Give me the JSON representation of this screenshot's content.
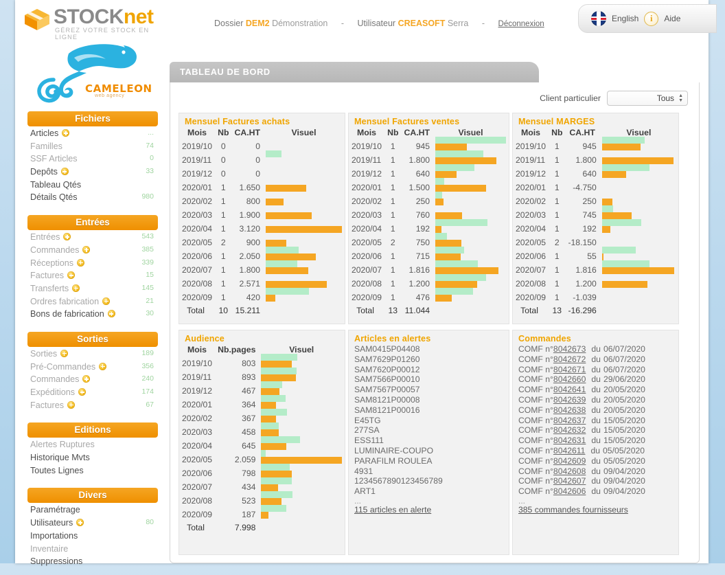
{
  "brand": {
    "name_stock": "STOCK",
    "name_net": "net",
    "tagline": "GÉREZ VOTRE STOCK EN LIGNE",
    "agency_name": "CAMELEON",
    "agency_sub": "web agency"
  },
  "topbar": {
    "dossier_label": "Dossier",
    "dossier_code": "DEM2",
    "dossier_name": "Démonstration",
    "sep": "-",
    "user_label": "Utilisateur",
    "user_code": "CREASOFT",
    "user_name": "Serra",
    "logout": "Déconnexion",
    "language": "English",
    "help": "Aide"
  },
  "page_title": "TABLEAU DE BORD",
  "filter": {
    "label": "Client particulier",
    "value": "Tous",
    "options": [
      "Tous"
    ]
  },
  "sidebar": {
    "sections": [
      {
        "title": "Fichiers",
        "items": [
          {
            "label": "Articles",
            "plus": true,
            "count": "...",
            "dim": false
          },
          {
            "label": "Familles",
            "plus": false,
            "count": "74",
            "dim": true
          },
          {
            "label": "SSF Articles",
            "plus": false,
            "count": "0",
            "dim": true
          },
          {
            "label": "Depôts",
            "plus": true,
            "count": "33",
            "dim": false
          },
          {
            "label": "Tableau Qtés",
            "plus": false,
            "count": "",
            "dim": false
          },
          {
            "label": "Détails Qtés",
            "plus": false,
            "count": "980",
            "dim": false
          }
        ]
      },
      {
        "title": "Entrées",
        "items": [
          {
            "label": "Entrées",
            "plus": true,
            "count": "543",
            "dim": true
          },
          {
            "label": "Commandes",
            "plus": true,
            "count": "385",
            "dim": true
          },
          {
            "label": "Réceptions",
            "plus": true,
            "count": "339",
            "dim": true
          },
          {
            "label": "Factures",
            "plus": true,
            "count": "15",
            "dim": true
          },
          {
            "label": "Transferts",
            "plus": true,
            "count": "145",
            "dim": true
          },
          {
            "label": "Ordres fabrication",
            "plus": true,
            "count": "21",
            "dim": true
          },
          {
            "label": "Bons de fabrication",
            "plus": true,
            "count": "30",
            "dim": false
          }
        ]
      },
      {
        "title": "Sorties",
        "items": [
          {
            "label": "Sorties",
            "plus": true,
            "count": "189",
            "dim": true
          },
          {
            "label": "Pré-Commandes",
            "plus": true,
            "count": "356",
            "dim": true
          },
          {
            "label": "Commandes",
            "plus": true,
            "count": "240",
            "dim": true
          },
          {
            "label": "Expéditions",
            "plus": true,
            "count": "174",
            "dim": true
          },
          {
            "label": "Factures",
            "plus": true,
            "count": "67",
            "dim": true
          }
        ]
      },
      {
        "title": "Editions",
        "items": [
          {
            "label": "Alertes Ruptures",
            "plus": false,
            "count": "",
            "dim": true
          },
          {
            "label": "Historique Mvts",
            "plus": false,
            "count": "",
            "dim": false
          },
          {
            "label": "Toutes Lignes",
            "plus": false,
            "count": "",
            "dim": false
          }
        ]
      },
      {
        "title": "Divers",
        "items": [
          {
            "label": "Paramétrage",
            "plus": false,
            "count": "",
            "dim": false
          },
          {
            "label": "Utilisateurs",
            "plus": true,
            "count": "80",
            "dim": false
          },
          {
            "label": "Importations",
            "plus": false,
            "count": "",
            "dim": false
          },
          {
            "label": "Inventaire",
            "plus": false,
            "count": "",
            "dim": true
          },
          {
            "label": "Suppressions",
            "plus": false,
            "count": "",
            "dim": false
          }
        ]
      }
    ]
  },
  "chart_data": [
    {
      "type": "bar",
      "title": "Mensuel Factures achats",
      "columns": [
        "Mois",
        "Nb",
        "CA.HT",
        "Visuel"
      ],
      "categories": [
        "2019/10",
        "2019/11",
        "2019/12",
        "2020/01",
        "2020/02",
        "2020/03",
        "2020/04",
        "2020/05",
        "2020/06",
        "2020/07",
        "2020/08",
        "2020/09"
      ],
      "nb": [
        "0",
        "0",
        "0",
        "1",
        "1",
        "1",
        "1",
        "2",
        "1",
        "1",
        "1",
        "1"
      ],
      "values": [
        0,
        0,
        0,
        1650,
        800,
        1900,
        3120,
        900,
        2050,
        1800,
        2571,
        420
      ],
      "orange_pct": [
        0,
        0,
        0,
        53,
        23,
        60,
        100,
        27,
        66,
        56,
        80,
        13
      ],
      "green_pct": [
        0,
        21,
        0,
        0,
        0,
        0,
        0,
        0,
        43,
        41,
        0,
        57
      ],
      "total_label": "Total",
      "total_nb": "10",
      "total_value": "15.211",
      "xlabel": "",
      "ylabel": "CA.HT"
    },
    {
      "type": "bar",
      "title": "Mensuel Factures ventes",
      "columns": [
        "Mois",
        "Nb",
        "CA.HT",
        "Visuel"
      ],
      "categories": [
        "2019/10",
        "2019/11",
        "2019/12",
        "2020/01",
        "2020/02",
        "2020/03",
        "2020/04",
        "2020/05",
        "2020/06",
        "2020/07",
        "2020/08",
        "2020/09"
      ],
      "nb": [
        "1",
        "1",
        "1",
        "1",
        "1",
        "1",
        "1",
        "2",
        "1",
        "1",
        "1",
        "1"
      ],
      "values": [
        945,
        1800,
        640,
        1500,
        250,
        760,
        192,
        750,
        715,
        1816,
        1200,
        476
      ],
      "orange_pct": [
        45,
        86,
        30,
        72,
        12,
        38,
        9,
        37,
        36,
        89,
        59,
        23
      ],
      "green_pct": [
        100,
        68,
        55,
        13,
        10,
        0,
        74,
        16,
        41,
        60,
        72,
        53
      ],
      "total_label": "Total",
      "total_nb": "13",
      "total_value": "11.044",
      "xlabel": "",
      "ylabel": "CA.HT"
    },
    {
      "type": "bar",
      "title": "Mensuel MARGES",
      "columns": [
        "Mois",
        "Nb",
        "CA.HT",
        "Visuel"
      ],
      "categories": [
        "2019/10",
        "2019/11",
        "2019/12",
        "2020/01",
        "2020/02",
        "2020/03",
        "2020/04",
        "2020/05",
        "2020/06",
        "2020/07",
        "2020/08",
        "2020/09"
      ],
      "nb": [
        "1",
        "1",
        "1",
        "1",
        "1",
        "1",
        "1",
        "2",
        "1",
        "1",
        "1",
        "1"
      ],
      "values": [
        945,
        1800,
        640,
        -4750,
        250,
        745,
        192,
        -18150,
        55,
        1816,
        1200,
        -1039
      ],
      "orange_pct": [
        52,
        97,
        33,
        0,
        14,
        40,
        11,
        0,
        2,
        98,
        62,
        0
      ],
      "green_pct": [
        58,
        0,
        65,
        0,
        0,
        15,
        53,
        0,
        46,
        65,
        0,
        0
      ],
      "total_label": "Total",
      "total_nb": "13",
      "total_value": "-16.296",
      "xlabel": "",
      "ylabel": "CA.HT"
    },
    {
      "type": "bar",
      "title": "Audience",
      "columns": [
        "Mois",
        "Nb.pages",
        "Visuel"
      ],
      "categories": [
        "2019/10",
        "2019/11",
        "2019/12",
        "2020/01",
        "2020/02",
        "2020/03",
        "2020/04",
        "2020/05",
        "2020/06",
        "2020/07",
        "2020/08",
        "2020/09"
      ],
      "values": [
        803,
        893,
        467,
        364,
        367,
        458,
        645,
        2059,
        798,
        434,
        523,
        187
      ],
      "orange_pct": [
        38,
        43,
        23,
        18,
        18,
        22,
        31,
        100,
        38,
        21,
        25,
        9
      ],
      "green_pct": [
        45,
        44,
        26,
        30,
        32,
        22,
        48,
        6,
        35,
        38,
        39,
        31
      ],
      "total_label": "Total",
      "total_value": "7.998",
      "xlabel": "",
      "ylabel": "Nb.pages"
    }
  ],
  "alerts": {
    "title": "Articles en alertes",
    "items": [
      "SAM0415P04408",
      "SAM7629P01260",
      "SAM7620P00012",
      "SAM7566P00010",
      "SAM7567P00057",
      "SAM8121P00008",
      "SAM8121P00016",
      "E45TG",
      "277SA",
      "ESS111",
      "LUMINAIRE-COUPO",
      "PARAFILM ROULEA",
      "4931",
      "1234567890123456789",
      "ART1"
    ],
    "ellipsis": "...",
    "more": "115 articles en alerte"
  },
  "orders": {
    "title": "Commandes",
    "prefix": "COMF n°",
    "du": "du",
    "items": [
      {
        "num": "8042673",
        "date": "06/07/2020"
      },
      {
        "num": "8042672",
        "date": "06/07/2020"
      },
      {
        "num": "8042671",
        "date": "06/07/2020"
      },
      {
        "num": "8042660",
        "date": "29/06/2020"
      },
      {
        "num": "8042641",
        "date": "20/05/2020"
      },
      {
        "num": "8042639",
        "date": "20/05/2020"
      },
      {
        "num": "8042638",
        "date": "20/05/2020"
      },
      {
        "num": "8042637",
        "date": "15/05/2020"
      },
      {
        "num": "8042632",
        "date": "15/05/2020"
      },
      {
        "num": "8042631",
        "date": "15/05/2020"
      },
      {
        "num": "8042611",
        "date": "05/05/2020"
      },
      {
        "num": "8042609",
        "date": "05/05/2020"
      },
      {
        "num": "8042608",
        "date": "09/04/2020"
      },
      {
        "num": "8042607",
        "date": "09/04/2020"
      },
      {
        "num": "8042606",
        "date": "09/04/2020"
      }
    ],
    "ellipsis": "...",
    "more": "385 commandes fournisseurs"
  },
  "colors": {
    "accent_orange": "#f5a623",
    "bar_green": "#b4ecc8",
    "title_orange": "#f0a500",
    "panel_gray": "#f2f2f2",
    "tab_gray": "#bcbcbc"
  }
}
